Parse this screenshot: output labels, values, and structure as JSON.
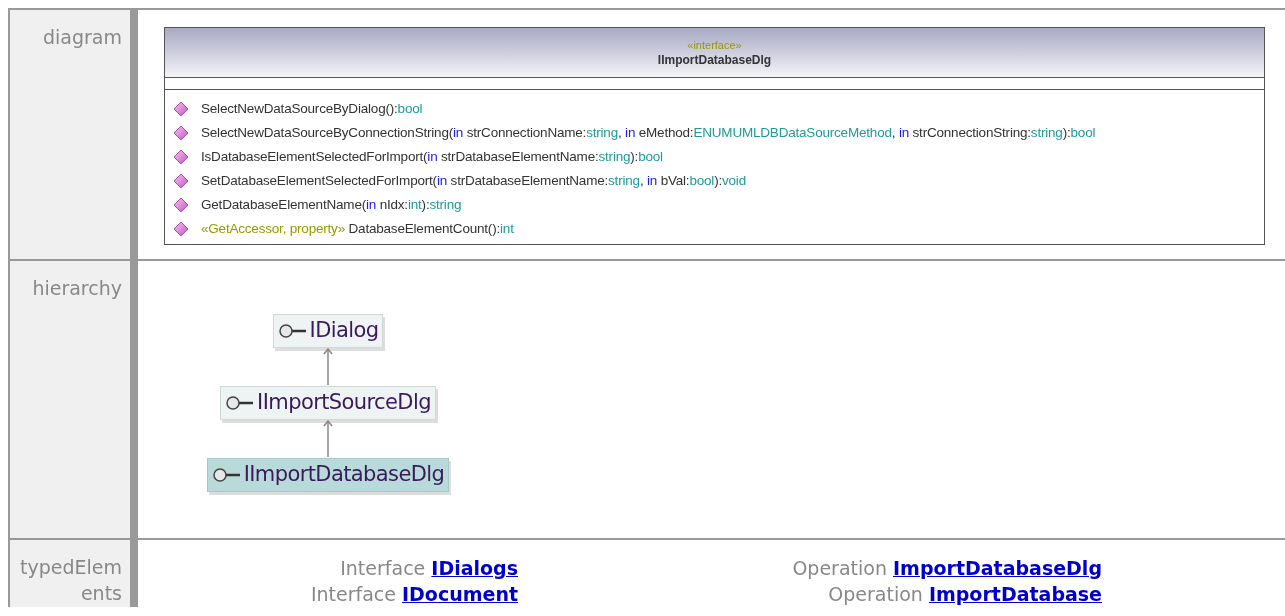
{
  "rows": [
    {
      "label": "diagram",
      "kind": "diagram"
    },
    {
      "label": "hierarchy",
      "kind": "hierarchy"
    },
    {
      "label": "typedElements",
      "kind": "typed"
    }
  ],
  "class_box": {
    "stereotype": "«interface»",
    "name": "IImportDatabaseDlg",
    "operations": [
      {
        "segments": [
          {
            "kind": "name",
            "text": "SelectNewDataSourceByDialog():"
          },
          {
            "kind": "type",
            "text": "bool"
          }
        ]
      },
      {
        "segments": [
          {
            "kind": "name",
            "text": "SelectNewDataSourceByConnectionString("
          },
          {
            "kind": "keyword",
            "text": "in"
          },
          {
            "kind": "name",
            "text": " strConnectionName:"
          },
          {
            "kind": "type",
            "text": "string"
          },
          {
            "kind": "name",
            "text": ", "
          },
          {
            "kind": "keyword",
            "text": "in"
          },
          {
            "kind": "name",
            "text": " eMethod:"
          },
          {
            "kind": "type",
            "text": "ENUMUMLDBDataSourceMethod"
          },
          {
            "kind": "name",
            "text": ", "
          },
          {
            "kind": "keyword",
            "text": "in"
          },
          {
            "kind": "name",
            "text": " strConnectionString:"
          },
          {
            "kind": "type",
            "text": "string"
          },
          {
            "kind": "name",
            "text": "):"
          },
          {
            "kind": "type",
            "text": "bool"
          }
        ]
      },
      {
        "segments": [
          {
            "kind": "name",
            "text": "IsDatabaseElementSelectedForImport("
          },
          {
            "kind": "keyword",
            "text": "in"
          },
          {
            "kind": "name",
            "text": " strDatabaseElementName:"
          },
          {
            "kind": "type",
            "text": "string"
          },
          {
            "kind": "name",
            "text": "):"
          },
          {
            "kind": "type",
            "text": "bool"
          }
        ]
      },
      {
        "segments": [
          {
            "kind": "name",
            "text": "SetDatabaseElementSelectedForImport("
          },
          {
            "kind": "keyword",
            "text": "in"
          },
          {
            "kind": "name",
            "text": " strDatabaseElementName:"
          },
          {
            "kind": "type",
            "text": "string"
          },
          {
            "kind": "name",
            "text": ", "
          },
          {
            "kind": "keyword",
            "text": "in"
          },
          {
            "kind": "name",
            "text": " bVal:"
          },
          {
            "kind": "type",
            "text": "bool"
          },
          {
            "kind": "name",
            "text": "):"
          },
          {
            "kind": "type",
            "text": "void"
          }
        ]
      },
      {
        "segments": [
          {
            "kind": "name",
            "text": "GetDatabaseElementName("
          },
          {
            "kind": "keyword",
            "text": "in"
          },
          {
            "kind": "name",
            "text": " nIdx:"
          },
          {
            "kind": "type",
            "text": "int"
          },
          {
            "kind": "name",
            "text": "):"
          },
          {
            "kind": "type",
            "text": "string"
          }
        ]
      },
      {
        "segments": [
          {
            "kind": "stereotype",
            "text": "«GetAccessor, property»"
          },
          {
            "kind": "name",
            "text": " DatabaseElementCount():"
          },
          {
            "kind": "type",
            "text": "int"
          }
        ]
      }
    ]
  },
  "hierarchy": [
    {
      "name": "IDialog",
      "selected": false
    },
    {
      "name": "IImportSourceDlg",
      "selected": false
    },
    {
      "name": "IImportDatabaseDlg",
      "selected": true
    }
  ],
  "typed_elements": [
    {
      "kind_label": "Interface",
      "link": "IDialogs"
    },
    {
      "kind_label": "Operation",
      "link": "ImportDatabaseDlg"
    },
    {
      "kind_label": "Interface",
      "link": "IDocument"
    },
    {
      "kind_label": "Operation",
      "link": "ImportDatabase"
    }
  ]
}
